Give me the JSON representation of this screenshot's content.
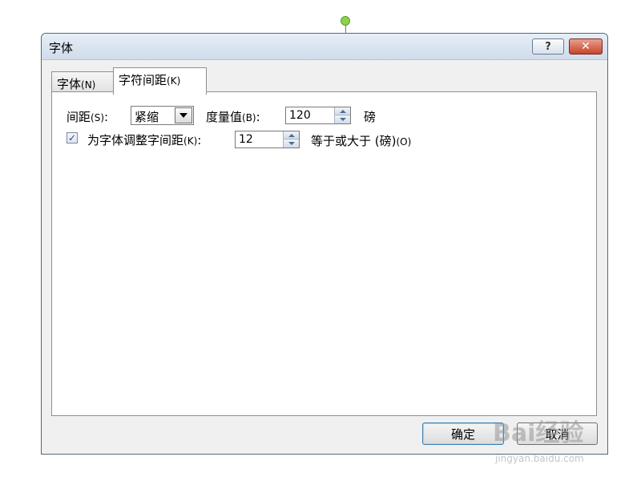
{
  "dialog": {
    "title": "字体",
    "help_glyph": "?",
    "close_glyph": "✕"
  },
  "tabs": [
    {
      "label": "字体",
      "mnemonic": "(N)"
    },
    {
      "label": "字符间距",
      "mnemonic": "(K)"
    }
  ],
  "spacing": {
    "label": "间距",
    "mnemonic": "(S)",
    "colon": ":",
    "value": "紧缩"
  },
  "amount": {
    "label": "度量值",
    "mnemonic": "(B)",
    "colon": ":",
    "value": "120",
    "unit": "磅"
  },
  "kerning": {
    "checked": true,
    "check_glyph": "✓",
    "label": "为字体调整字间距",
    "mnemonic": "(K)",
    "colon": ":",
    "value": "12",
    "suffix": "等于或大于 (磅)",
    "suffix_mnemonic": "(O)"
  },
  "buttons": {
    "ok": "确定",
    "cancel": "取消"
  },
  "watermark": {
    "brand": "Bai经验",
    "url": "jingyan.baidu.com"
  }
}
